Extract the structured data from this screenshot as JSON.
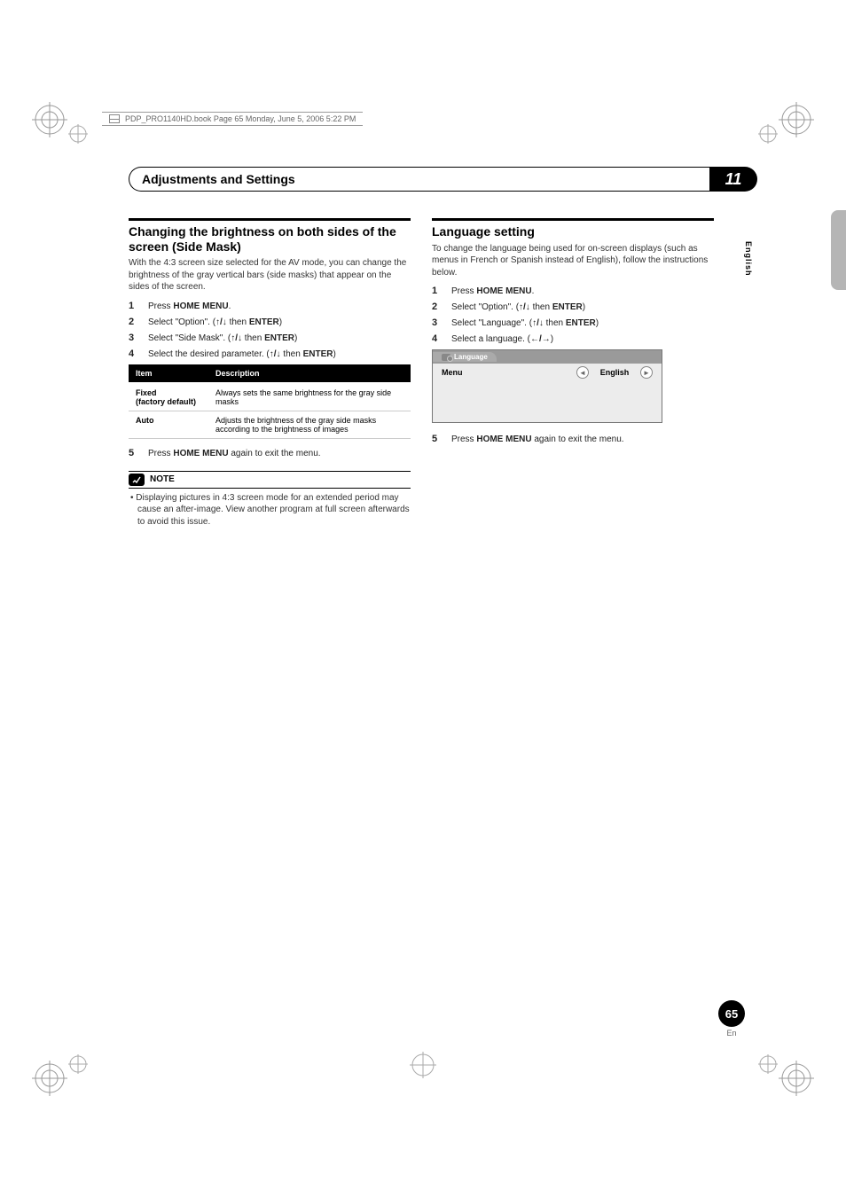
{
  "book_header": "PDP_PRO1140HD.book  Page 65  Monday, June 5, 2006  5:22 PM",
  "chapter": {
    "title": "Adjustments and Settings",
    "number": "11"
  },
  "vertical_lang": "English",
  "left": {
    "title": "Changing the brightness on both sides of the screen (Side Mask)",
    "intro": "With the 4:3 screen size selected for the AV mode, you can change the brightness of the gray vertical bars (side masks) that appear on the sides of the screen.",
    "steps": [
      {
        "num": "1",
        "pre": "Press ",
        "bold": "HOME MENU",
        "post": "."
      },
      {
        "num": "2",
        "pre": "Select \"Option\". (",
        "arrows": "↑/↓",
        "mid": " then ",
        "bold": "ENTER",
        "post": ")"
      },
      {
        "num": "3",
        "pre": "Select \"Side Mask\". (",
        "arrows": "↑/↓",
        "mid": " then ",
        "bold": "ENTER",
        "post": ")"
      },
      {
        "num": "4",
        "pre": "Select the desired parameter. (",
        "arrows": "↑/↓",
        "mid": " then ",
        "bold": "ENTER",
        "post": ")"
      }
    ],
    "table": {
      "headers": [
        "Item",
        "Description"
      ],
      "rows": [
        {
          "item_line1": "Fixed",
          "item_line2": "(factory default)",
          "desc": "Always sets the same brightness for the gray side masks"
        },
        {
          "item_line1": "Auto",
          "item_line2": "",
          "desc": "Adjusts the brightness of the gray side masks according to the brightness of images"
        }
      ]
    },
    "step5": {
      "num": "5",
      "pre": "Press ",
      "bold": "HOME MENU",
      "post": " again to exit the menu."
    },
    "note_label": "NOTE",
    "note_text": "Displaying pictures in 4:3 screen mode for an extended period may cause an after-image. View another program at full screen afterwards to avoid this issue."
  },
  "right": {
    "title": "Language setting",
    "intro": "To change the language being used for on-screen displays (such as menus in French or Spanish instead of English), follow the instructions below.",
    "steps": [
      {
        "num": "1",
        "pre": "Press ",
        "bold": "HOME MENU",
        "post": "."
      },
      {
        "num": "2",
        "pre": "Select \"Option\". (",
        "arrows": "↑/↓",
        "mid": " then ",
        "bold": "ENTER",
        "post": ")"
      },
      {
        "num": "3",
        "pre": "Select \"Language\". (",
        "arrows": "↑/↓",
        "mid": " then ",
        "bold": "ENTER",
        "post": ")"
      },
      {
        "num": "4",
        "pre": "Select a language. (",
        "arrows": "←/→",
        "post": ")"
      }
    ],
    "osd": {
      "tab_label": "Language",
      "row_label": "Menu",
      "row_value": "English",
      "arrow_left": "◄",
      "arrow_right": "►"
    },
    "step5": {
      "num": "5",
      "pre": "Press ",
      "bold": "HOME MENU",
      "post": " again to exit the menu."
    }
  },
  "page": {
    "number": "65",
    "lang_short": "En"
  }
}
